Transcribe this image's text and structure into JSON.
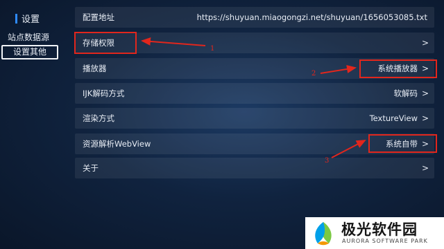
{
  "sidebar": {
    "title": "设置",
    "items": [
      {
        "label": "站点数据源"
      },
      {
        "label": "设置其他"
      }
    ]
  },
  "settings": [
    {
      "label": "配置地址",
      "value": "https://shuyuan.miaogongzi.net/shuyuan/1656053085.txt",
      "chevron": ">"
    },
    {
      "label": "存储权限",
      "value": "",
      "chevron": ">"
    },
    {
      "label": "播放器",
      "value": "系统播放器",
      "chevron": ">"
    },
    {
      "label": "IJK解码方式",
      "value": "软解码",
      "chevron": ">"
    },
    {
      "label": "渲染方式",
      "value": "TextureView",
      "chevron": ">"
    },
    {
      "label": "资源解析WebView",
      "value": "系统自带",
      "chevron": ">"
    },
    {
      "label": "关于",
      "value": "",
      "chevron": ">"
    }
  ],
  "annotations": {
    "n1": "1",
    "n2": "2",
    "n3": "3",
    "color": "#e2261c"
  },
  "watermark": {
    "cn": "极光软件园",
    "en": "AURORA SOFTWARE PARK"
  }
}
